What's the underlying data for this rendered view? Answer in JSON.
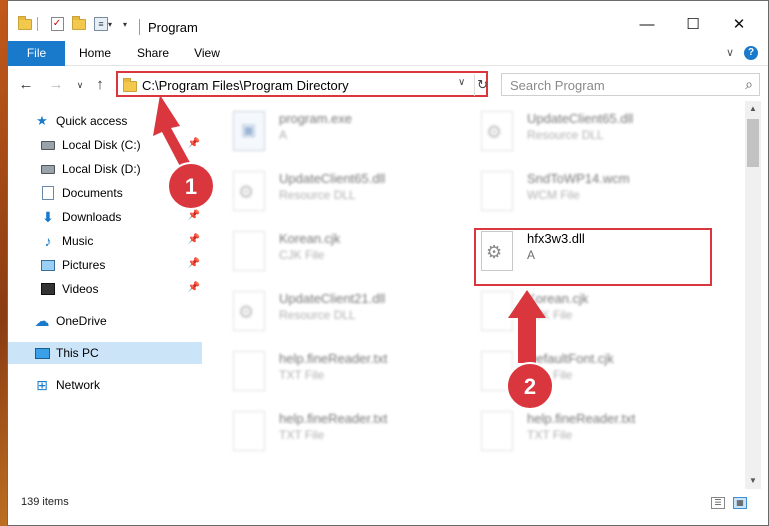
{
  "window": {
    "title": "Program",
    "controls": {
      "minimize": "—",
      "maximize": "☐",
      "close": "✕"
    }
  },
  "ribbon": {
    "tabs": [
      "File",
      "Home",
      "Share",
      "View"
    ],
    "expand_glyph": "∨",
    "help_glyph": "?"
  },
  "nav_buttons": {
    "back": "←",
    "forward": "→",
    "recent": "∨",
    "up": "↑"
  },
  "address": {
    "path": "C:\\Program Files\\Program Directory",
    "dropdown_glyph": "∨",
    "refresh_glyph": "↻"
  },
  "search": {
    "placeholder": "Search Program",
    "icon_glyph": "⌕"
  },
  "sidebar": {
    "items": [
      {
        "label": "Quick access",
        "icon": "star-icon",
        "pinned": false
      },
      {
        "label": "Local Disk (C:)",
        "icon": "drive-icon",
        "pinned": true
      },
      {
        "label": "Local Disk (D:)",
        "icon": "drive-icon",
        "pinned": false
      },
      {
        "label": "Documents",
        "icon": "document-icon",
        "pinned": true
      },
      {
        "label": "Downloads",
        "icon": "download-icon",
        "pinned": true
      },
      {
        "label": "Music",
        "icon": "music-icon",
        "pinned": true
      },
      {
        "label": "Pictures",
        "icon": "pictures-icon",
        "pinned": true
      },
      {
        "label": "Videos",
        "icon": "videos-icon",
        "pinned": true
      },
      {
        "label": "OneDrive",
        "icon": "onedrive-icon",
        "pinned": false
      },
      {
        "label": "This PC",
        "icon": "this-pc-icon",
        "pinned": false,
        "selected": true
      },
      {
        "label": "Network",
        "icon": "network-icon",
        "pinned": false
      }
    ],
    "pin_glyph": "📌"
  },
  "files": [
    {
      "name": "program.exe",
      "type": "A",
      "kind": "exe"
    },
    {
      "name": "UpdateClient65.dll",
      "type": "Resource DLL",
      "kind": "dll"
    },
    {
      "name": "UpdateClient65.dll",
      "type": "Resource DLL",
      "kind": "dll"
    },
    {
      "name": "SndToWP14.wcm",
      "type": "WCM File",
      "kind": "generic"
    },
    {
      "name": "Korean.cjk",
      "type": "CJK File",
      "kind": "generic"
    },
    {
      "name": "hfx3w3.dll",
      "type": "A",
      "kind": "dll",
      "highlighted": true
    },
    {
      "name": "UpdateClient21.dll",
      "type": "Resource DLL",
      "kind": "dll"
    },
    {
      "name": "Korean.cjk",
      "type": "CJK File",
      "kind": "generic"
    },
    {
      "name": "help.fineReader.txt",
      "type": "TXT File",
      "kind": "generic"
    },
    {
      "name": "DefaultFont.cjk",
      "type": "CJK File",
      "kind": "generic"
    },
    {
      "name": "help.fineReader.txt",
      "type": "TXT File",
      "kind": "generic"
    },
    {
      "name": "help.fineReader.txt",
      "type": "TXT File",
      "kind": "generic"
    }
  ],
  "annotations": {
    "step1": "1",
    "step2": "2",
    "color": "#d9363e"
  },
  "status": {
    "item_count": "139 items"
  },
  "colors": {
    "accent": "#1979ca",
    "selection": "#cce4f7",
    "annotation_red": "#d9363e"
  }
}
